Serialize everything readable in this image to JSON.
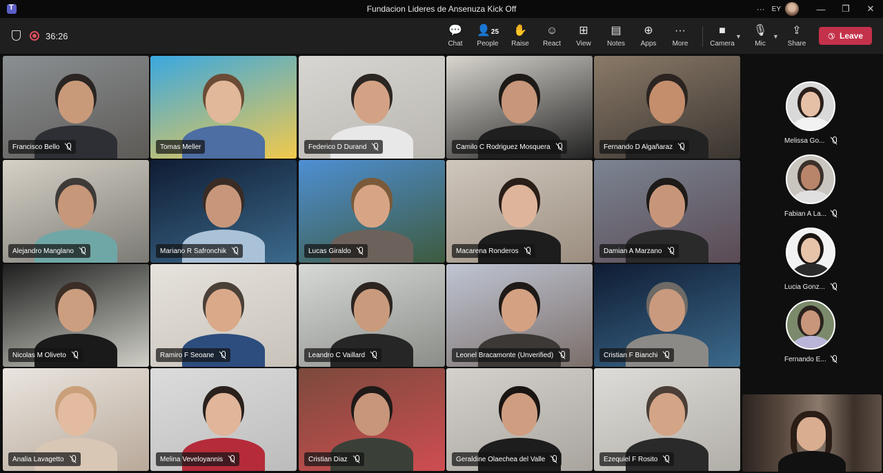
{
  "window": {
    "title": "Fundacion Lideres de Ansenuza Kick Off",
    "more_label": "···",
    "user_initials": "EY",
    "controls": [
      "—",
      "❐",
      "✕"
    ]
  },
  "toolbar": {
    "timer": "36:26",
    "buttons": [
      {
        "id": "chat",
        "label": "Chat",
        "icon": "chat-icon",
        "glyph": "💬"
      },
      {
        "id": "people",
        "label": "People",
        "icon": "people-icon",
        "glyph": "👤",
        "count": "25"
      },
      {
        "id": "raise",
        "label": "Raise",
        "icon": "hand-icon",
        "glyph": "✋"
      },
      {
        "id": "react",
        "label": "React",
        "icon": "smile-icon",
        "glyph": "☺"
      },
      {
        "id": "view",
        "label": "View",
        "icon": "grid-icon",
        "glyph": "⊞"
      },
      {
        "id": "notes",
        "label": "Notes",
        "icon": "notes-icon",
        "glyph": "▤"
      },
      {
        "id": "apps",
        "label": "Apps",
        "icon": "plus-icon",
        "glyph": "⊕"
      },
      {
        "id": "more",
        "label": "More",
        "icon": "ellipsis-icon",
        "glyph": "···"
      },
      {
        "id": "camera",
        "label": "Camera",
        "icon": "camera-icon",
        "glyph": "■"
      },
      {
        "id": "mic",
        "label": "Mic",
        "icon": "mic-icon",
        "glyph": "🎙"
      },
      {
        "id": "share",
        "label": "Share",
        "icon": "share-icon",
        "glyph": "⇪"
      }
    ],
    "leave_label": "Leave"
  },
  "participants": [
    {
      "name": "Francisco Bello",
      "muted": true,
      "bg": "#8a8f92",
      "bg2": "#5d5a56",
      "skin": "#c99a7a",
      "shirt": "#2d2f35",
      "hair": "#2a2522"
    },
    {
      "name": "Tomas Meller",
      "muted": false,
      "bg": "#3aa8e0",
      "bg2": "#f2c94c",
      "skin": "#e1b899",
      "shirt": "#4d6ea3",
      "hair": "#6b4b35"
    },
    {
      "name": "Federico D Durand",
      "muted": true,
      "bg": "#d8d6d2",
      "bg2": "#b9b6b0",
      "skin": "#d3a284",
      "shirt": "#e8e8e8",
      "hair": "#2c2622"
    },
    {
      "name": "Camilo C Rodriguez Mosquera",
      "muted": true,
      "bg": "#d9d6cf",
      "bg2": "#222",
      "skin": "#c8967a",
      "shirt": "#1f1f1f",
      "hair": "#1e1a18"
    },
    {
      "name": "Fernando D Algañaraz",
      "muted": true,
      "bg": "#8a7a68",
      "bg2": "#3a3430",
      "skin": "#c48e6c",
      "shirt": "#222",
      "hair": "#2b2420"
    },
    {
      "name": "Alejandro Manglano",
      "muted": true,
      "bg": "#d6d1c7",
      "bg2": "#7b7a74",
      "skin": "#c69778",
      "shirt": "#6fa7a6",
      "hair": "#3d3a38"
    },
    {
      "name": "Mariano R Safronchik",
      "muted": true,
      "bg": "#0f1c33",
      "bg2": "#3c6a8c",
      "skin": "#c8977b",
      "shirt": "#a9c2d8",
      "hair": "#3a2c24"
    },
    {
      "name": "Lucas Giraldo",
      "muted": true,
      "bg": "#4e8fd3",
      "bg2": "#3e5a3e",
      "skin": "#d7a585",
      "shirt": "#6d625b",
      "hair": "#7a5a3a"
    },
    {
      "name": "Macarena Ronderos",
      "muted": true,
      "bg": "#cfc7bd",
      "bg2": "#9b8e80",
      "skin": "#deb59b",
      "shirt": "#1d1d1d",
      "hair": "#2a1e18"
    },
    {
      "name": "Damian A Marzano",
      "muted": true,
      "bg": "#7b8492",
      "bg2": "#5a4a54",
      "skin": "#c7967a",
      "shirt": "#2a2a2a",
      "hair": "#1d1a18"
    },
    {
      "name": "Nicolas M Oliveto",
      "muted": true,
      "bg": "#1e1e1e",
      "bg2": "#d0d0c8",
      "skin": "#cc9e80",
      "shirt": "#1a1a1a",
      "hair": "#3b2e26"
    },
    {
      "name": "Ramiro F Seoane",
      "muted": true,
      "bg": "#e6e2dc",
      "bg2": "#c8c2ba",
      "skin": "#d9a98a",
      "shirt": "#2d4d7e",
      "hair": "#4a4038"
    },
    {
      "name": "Leandro C Vaillard",
      "muted": true,
      "bg": "#d7d9d6",
      "bg2": "#8a8d88",
      "skin": "#c99b7c",
      "shirt": "#262626",
      "hair": "#2c2420"
    },
    {
      "name": "Leonel Bracamonte (Unverified)",
      "muted": true,
      "bg": "#bfc5d3",
      "bg2": "#7b6e6a",
      "skin": "#d5a183",
      "shirt": "#3b3836",
      "hair": "#1f1a17"
    },
    {
      "name": "Cristian F Bianchi",
      "muted": true,
      "bg": "#0f1c33",
      "bg2": "#3c6a8c",
      "skin": "#c99a7e",
      "shirt": "#8c8a86",
      "hair": "#6e6a66"
    },
    {
      "name": "Analia Lavagetto",
      "muted": true,
      "bg": "#e9e5df",
      "bg2": "#b9a99a",
      "skin": "#e2bba0",
      "shirt": "#d9c7b6",
      "hair": "#c9a07a"
    },
    {
      "name": "Melina Veveloyannis",
      "muted": true,
      "bg": "#dcdcdc",
      "bg2": "#bcbcbc",
      "skin": "#e0b59a",
      "shirt": "#b52b3a",
      "hair": "#2a211c"
    },
    {
      "name": "Cristian Diaz",
      "muted": true,
      "bg": "#7b4a3c",
      "bg2": "#cf4d52",
      "skin": "#c8967a",
      "shirt": "#3a4038",
      "hair": "#1e1a18"
    },
    {
      "name": "Geraldine Olaechea del Valle",
      "muted": true,
      "bg": "#d4d1cc",
      "bg2": "#a9a49e",
      "skin": "#cf9e80",
      "shirt": "#1d1d1d",
      "hair": "#1a1512"
    },
    {
      "name": "Ezequiel F Rosito",
      "muted": true,
      "bg": "#dedcd8",
      "bg2": "#b1aea8",
      "skin": "#d4a487",
      "shirt": "#2a2a2a",
      "hair": "#4a3e36"
    }
  ],
  "sidebar": [
    {
      "name": "Melissa Go...",
      "muted": true,
      "skin": "#e5c0a6",
      "hair": "#2a1f1a",
      "shirt": "#f2f2f2",
      "bg": "#d9d9d9"
    },
    {
      "name": "Fabian A La...",
      "muted": true,
      "skin": "#b9856a",
      "hair": "#3a302a",
      "shirt": "#e0e0e0",
      "bg": "#c9c5bf"
    },
    {
      "name": "Lucia Gonz...",
      "muted": true,
      "skin": "#e7c3aa",
      "hair": "#1b1512",
      "shirt": "#2a2a2a",
      "bg": "#f2f2f2"
    },
    {
      "name": "Fernando E...",
      "muted": true,
      "skin": "#c8967a",
      "hair": "#2a221e",
      "shirt": "#b9b5d8",
      "bg": "#7a8a6a"
    }
  ]
}
